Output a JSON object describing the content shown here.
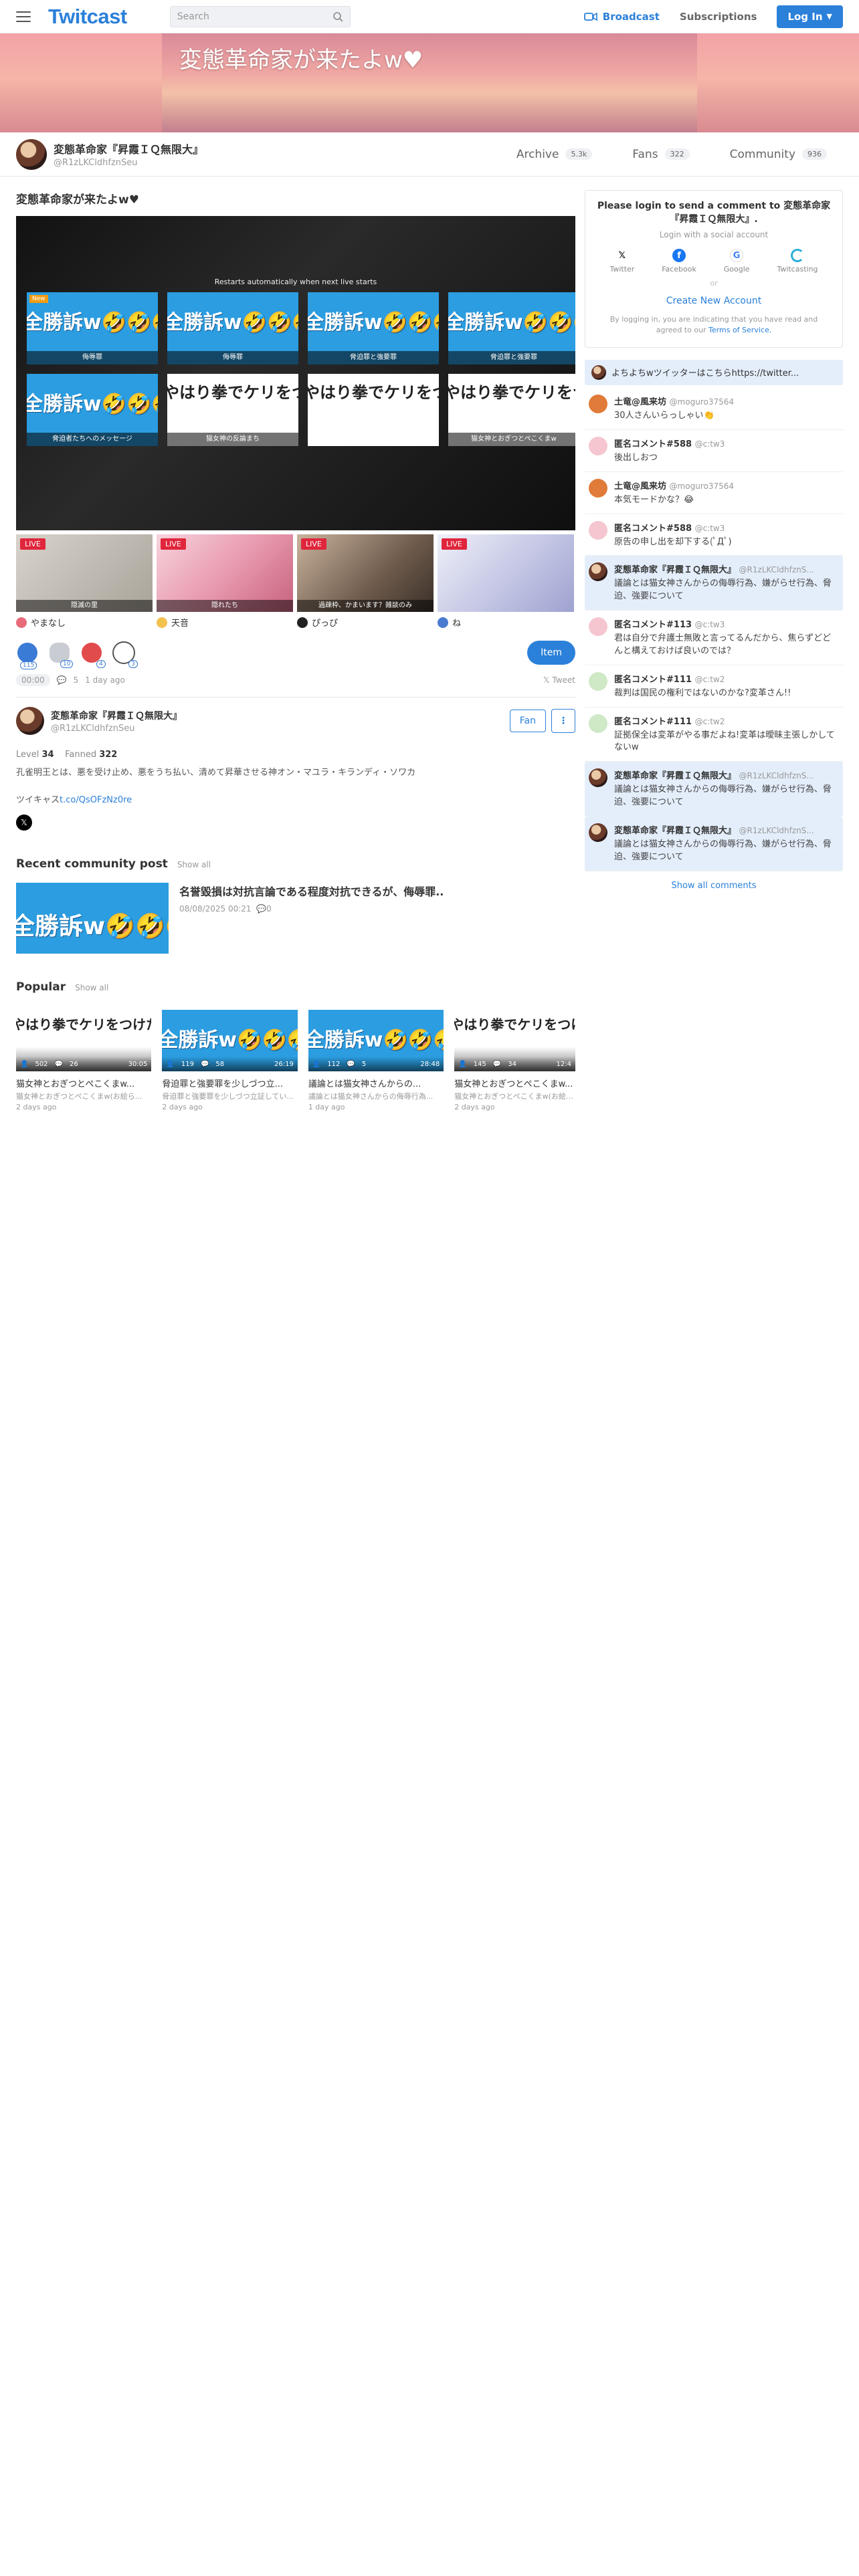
{
  "header": {
    "logo": "Twitcast",
    "search_placeholder": "Search",
    "broadcast": "Broadcast",
    "subscriptions": "Subscriptions",
    "login": "Log In",
    "accent": "#2b80d9"
  },
  "banner": {
    "title": "変態革命家が来たよw♥"
  },
  "channel": {
    "name": "変態革命家『昇霞ＩＱ無限大』",
    "id": "@R1zLKCldhfznSeu",
    "tabs": [
      {
        "label": "Archive",
        "count": "5.3k"
      },
      {
        "label": "Fans",
        "count": "322"
      },
      {
        "label": "Community",
        "count": "936"
      }
    ]
  },
  "stream": {
    "title": "変態革命家が来たよw♥",
    "restart_note": "Restarts automatically when next live starts",
    "player_cards": [
      {
        "big": "全勝訴w🤣🤣🤣",
        "cap": "侮辱罪",
        "new": "New"
      },
      {
        "big": "全勝訴w🤣🤣🤣",
        "cap": "侮辱罪"
      },
      {
        "big": "全勝訴w🤣🤣🤣",
        "cap": "脅迫罪と強要罪"
      },
      {
        "big": "全勝訴w🤣🤣🤣",
        "cap": "脅迫罪と強要罪"
      },
      {
        "big": "全勝訴w🤣🤣🤣",
        "cap": "脅迫者たちへのメッセージ"
      },
      {
        "big": "やはり拳でケリをつけた",
        "cap": "猫女神の反論まち"
      },
      {
        "big": "やはり拳でケリをつけた",
        "cap": ""
      },
      {
        "big": "やはり拳でケリをつけた",
        "cap": "猫女神とおぎつとぺこくまw"
      }
    ],
    "time": "00:00",
    "comments": "5",
    "ago": "1 day ago",
    "tweet": "Tweet",
    "item_button": "Item",
    "gift_counts": [
      "115",
      "10",
      "4",
      "3"
    ]
  },
  "live_now": [
    {
      "label": "LIVE",
      "overlay": "隠滅の里",
      "name": "やまなし"
    },
    {
      "label": "LIVE",
      "overlay": "隠れたち",
      "name": "天音"
    },
    {
      "label": "LIVE",
      "overlay": "過疎枠、かまいます？雑談のみ",
      "name": "ぴっぴ"
    },
    {
      "label": "LIVE",
      "overlay": "",
      "name": "ね"
    }
  ],
  "owner": {
    "name": "変態革命家『昇霞ＩＱ無限大』",
    "id": "@R1zLKCldhfznSeu",
    "fan": "Fan",
    "more": "⋮",
    "level_label": "Level",
    "level": "34",
    "fanned_label": "Fanned",
    "fanned": "322",
    "description": "孔雀明王とは、悪を受け止め、悪をうち払い、清めて昇華させる神オン・マユラ・キランディ・ソワカ",
    "twitter_prefix": "ツイキャス",
    "twitter_link": "t.co/QsOFzNz0re"
  },
  "community": {
    "heading": "Recent community post",
    "show_all": "Show all",
    "post_big": "全勝訴w🤣🤣🤣",
    "post_title": "名誉毀損は対抗言論である程度対抗できるが、侮辱罪..",
    "post_date": "08/08/2025 00:21",
    "post_comments": "0"
  },
  "popular": {
    "heading": "Popular",
    "show_all": "Show all",
    "items": [
      {
        "big": "やはり拳でケリをつけた",
        "views": "502",
        "comments": "26",
        "duration": "30:05",
        "title": "猫女神とおぎつとぺこくまw...",
        "sub": "猫女神とおぎつとぺこくまw(お絵ら...",
        "ago": "2 days ago",
        "white": true
      },
      {
        "big": "全勝訴w🤣🤣🤣",
        "views": "119",
        "comments": "58",
        "duration": "26:19",
        "title": "脅迫罪と強要罪を少しづつ立...",
        "sub": "脅迫罪と強要罪を少しづつ立証してい...",
        "ago": "2 days ago",
        "white": false
      },
      {
        "big": "全勝訴w🤣🤣🤣",
        "views": "112",
        "comments": "5",
        "duration": "28:48",
        "title": "議論とは猫女神さんからの...",
        "sub": "議論とは猫女神さんからの侮辱行為...",
        "ago": "1 day ago",
        "white": false
      },
      {
        "big": "やはり拳でケリをつけた",
        "views": "145",
        "comments": "34",
        "duration": "12:4",
        "title": "猫女神とおぎつとぺこくまw...",
        "sub": "猫女神とおぎつとぺこくまw(お絵ら...",
        "ago": "2 days ago",
        "white": true
      }
    ]
  },
  "login_box": {
    "title": "Please login to send a comment to 変態革命家『昇霞ＩＱ無限大』.",
    "sub": "Login with a social account",
    "socials": [
      "Twitter",
      "Facebook",
      "Google",
      "Twitcasting"
    ],
    "or": "or",
    "create": "Create New Account",
    "tos_prefix": "By logging in, you are indicating that you have read and agreed to our ",
    "tos_link": "Terms of Service."
  },
  "pinned": "よちよちwツイッターはこちらhttps://twitter...",
  "comments": [
    {
      "name": "土竜@風来坊",
      "id": "@moguro37564",
      "text": "30人さんいらっしゃい👏",
      "own": false,
      "av": "#e07b39"
    },
    {
      "name": "匿名コメント#588",
      "id": "@c:tw3",
      "text": "後出しおつ",
      "own": false,
      "av": "#f5c6cf"
    },
    {
      "name": "土竜@風来坊",
      "id": "@moguro37564",
      "text": "本気モードかな？😂",
      "own": false,
      "av": "#e07b39"
    },
    {
      "name": "匿名コメント#588",
      "id": "@c:tw3",
      "text": "原告の申し出を却下する(ﾟДﾟ)",
      "own": false,
      "av": "#f5c6cf"
    },
    {
      "name": "変態革命家『昇霞ＩＱ無限大』",
      "id": "@R1zLKCldhfznS...",
      "text": "議論とは猫女神さんからの侮辱行為、嫌がらせ行為、脅迫、強要について",
      "own": true,
      "av": "#6a3b2a"
    },
    {
      "name": "匿名コメント#113",
      "id": "@c:tw3",
      "text": "君は自分で弁護士無敗と言ってるんだから、焦らずどどんと構えておけば良いのでは？",
      "own": false,
      "av": "#f5c6cf"
    },
    {
      "name": "匿名コメント#111",
      "id": "@c:tw2",
      "text": "裁判は国民の権利ではないのかな?変革さん!!",
      "own": false,
      "av": "#cfe8c6"
    },
    {
      "name": "匿名コメント#111",
      "id": "@c:tw2",
      "text": "証拠保全は変革がやる事だよね!変革は曖昧主張しかしてないw",
      "own": false,
      "av": "#cfe8c6"
    },
    {
      "name": "変態革命家『昇霞ＩＱ無限大』",
      "id": "@R1zLKCldhfznS...",
      "text": "議論とは猫女神さんからの侮辱行為、嫌がらせ行為、脅迫、強要について",
      "own": true,
      "av": "#6a3b2a"
    },
    {
      "name": "変態革命家『昇霞ＩＱ無限大』",
      "id": "@R1zLKCldhfznS...",
      "text": "議論とは猫女神さんからの侮辱行為、嫌がらせ行為、脅迫、強要について",
      "own": true,
      "av": "#6a3b2a"
    }
  ],
  "show_all_comments": "Show all comments"
}
